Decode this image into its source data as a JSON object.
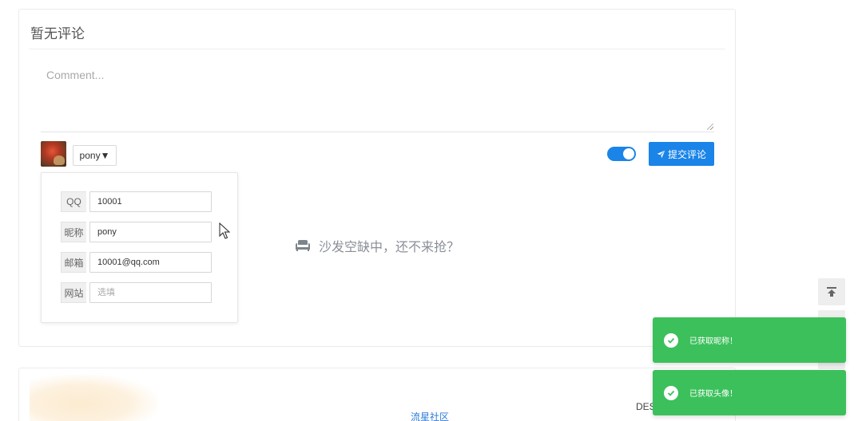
{
  "comment_card": {
    "title": "暂无评论",
    "textarea_placeholder": "Comment...",
    "nickname_select": "pony▼",
    "submit_label": "提交评论",
    "toggle_on": true,
    "empty_message": "沙发空缺中，还不来抢？"
  },
  "info_panel": {
    "fields": [
      {
        "label": "QQ",
        "value": "10001",
        "placeholder": ""
      },
      {
        "label": "昵称",
        "value": "pony",
        "placeholder": ""
      },
      {
        "label": "邮箱",
        "value": "10001@qq.com",
        "placeholder": ""
      },
      {
        "label": "网站",
        "value": "",
        "placeholder": "选填"
      }
    ]
  },
  "footer": {
    "link": "流星社区",
    "right_text": "DES"
  },
  "toasts": [
    {
      "message": "已获取昵称！"
    },
    {
      "message": "已获取头像！"
    }
  ],
  "icons": {
    "submit": "paper-plane-icon",
    "empty": "sofa-icon",
    "to_top": "arrow-to-top-icon",
    "toast": "check-circle-icon"
  },
  "colors": {
    "primary": "#1a84e8",
    "success": "#3cc05b",
    "link": "#2d7bd8"
  }
}
